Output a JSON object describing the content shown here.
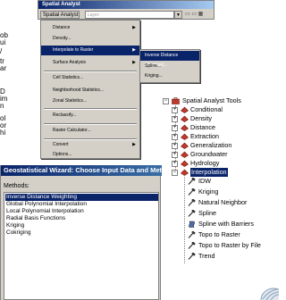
{
  "left_fragments": [
    "ob",
    "ui",
    "/",
    "tr",
    "ar",
    "D",
    "im",
    "n",
    "ol",
    "or",
    "hi",
    "e"
  ],
  "toolbar": {
    "title": "Spatial Analyst",
    "menu_button": "Spatial Analyst ▼",
    "layer_field": "Layer:",
    "dropdown_arrow": "▼",
    "icons": "▭ ▭ ▦"
  },
  "menu": {
    "items": [
      "Distance",
      "Density...",
      "Interpolate to Raster",
      "Surface Analysis",
      "Cell Statistics...",
      "Neighborhood Statistics...",
      "Zonal Statistics...",
      "Reclassify...",
      "Raster Calculator...",
      "Convert",
      "Options..."
    ],
    "arrow": "▶"
  },
  "submenu": {
    "items": [
      "Inverse Distance Weighted...",
      "Spline...",
      "Kriging..."
    ]
  },
  "tree": {
    "root": "Spatial Analyst Tools",
    "toolsets": [
      "Conditional",
      "Density",
      "Distance",
      "Extraction",
      "Generalization",
      "Groundwater",
      "Hydrology",
      "Interpolation"
    ],
    "tools": [
      "IDW",
      "Kriging",
      "Natural Neighbor",
      "Spline",
      "Spline with Barriers",
      "Topo to Raster",
      "Topo to Raster by File",
      "Trend"
    ],
    "plus": "+",
    "minus": "−"
  },
  "wizard": {
    "title": "Geostatistical Wizard: Choose Input Data and Method",
    "methods_label": "Methods:",
    "methods": [
      "Inverse Distance Weighting",
      "Global Polynomial Interpolation",
      "Local Polynomial Interpolation",
      "Radial Basis Functions",
      "Kriging",
      "Cokriging"
    ]
  },
  "colors": {
    "selection": "#0a246a",
    "face": "#d4d0c8",
    "toolset_icon": "#c0392b",
    "tool_icon": "#333333"
  }
}
